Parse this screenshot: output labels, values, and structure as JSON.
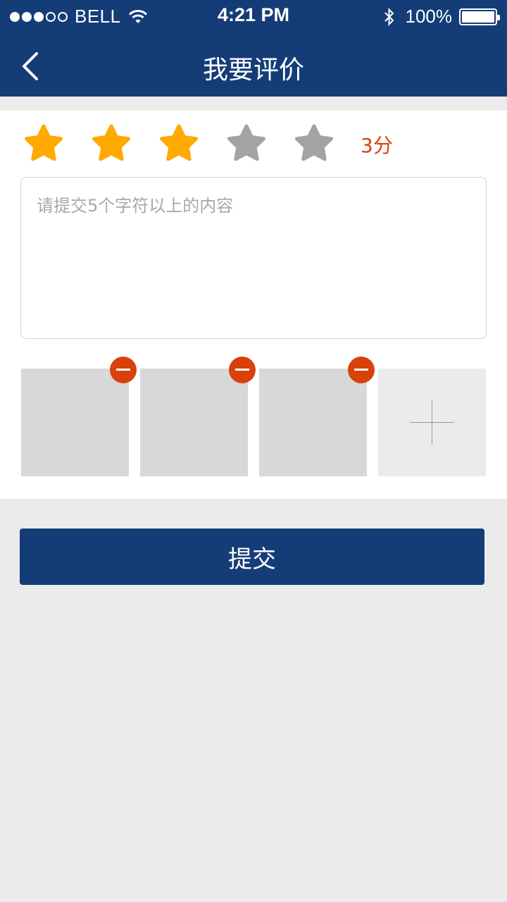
{
  "status_bar": {
    "carrier": "BELL",
    "time": "4:21 PM",
    "battery": "100%",
    "signal_bars": 3,
    "signal_total": 5
  },
  "nav": {
    "title": "我要评价",
    "back_icon": "chevron-left-icon"
  },
  "rating": {
    "value": 3,
    "max": 5,
    "score_label": "3分",
    "active_color": "#FFAA00",
    "inactive_color": "#A3A3A3"
  },
  "comment": {
    "value": "",
    "placeholder": "请提交5个字符以上的内容"
  },
  "photos": {
    "count": 3,
    "remove_icon": "minus-circle-icon",
    "add_icon": "plus-icon"
  },
  "submit": {
    "label": "提交"
  },
  "colors": {
    "brand": "#143D78",
    "accent": "#D9400A",
    "background": "#EBEBEB"
  }
}
